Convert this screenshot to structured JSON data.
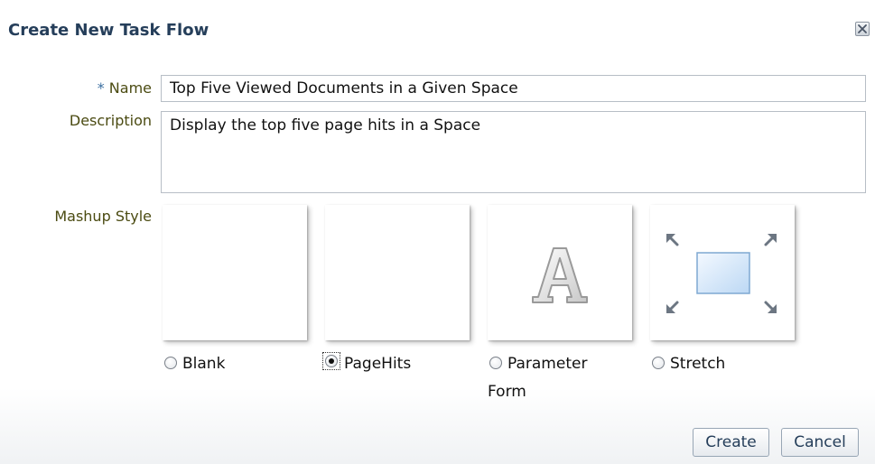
{
  "dialog": {
    "title": "Create New Task Flow",
    "close_icon": "close-icon"
  },
  "form": {
    "name_required_mark": "*",
    "name_label": "Name",
    "name_value": "Top Five Viewed Documents in a Given Space",
    "description_label": "Description",
    "description_value": "Display the top five page hits in a Space",
    "mashup_label": "Mashup Style"
  },
  "mashup_options": [
    {
      "label": "Blank",
      "selected": false
    },
    {
      "label": "PageHits",
      "selected": true
    },
    {
      "label_line1": "Parameter",
      "label_line2": "Form",
      "selected": false,
      "icon": "letter-a-icon"
    },
    {
      "label": "Stretch",
      "selected": false,
      "icon": "stretch-arrows-icon"
    }
  ],
  "buttons": {
    "create": "Create",
    "cancel": "Cancel"
  },
  "colors": {
    "title": "#253e5a",
    "label": "#4b4b12",
    "required_mark": "#3b6fa0"
  }
}
